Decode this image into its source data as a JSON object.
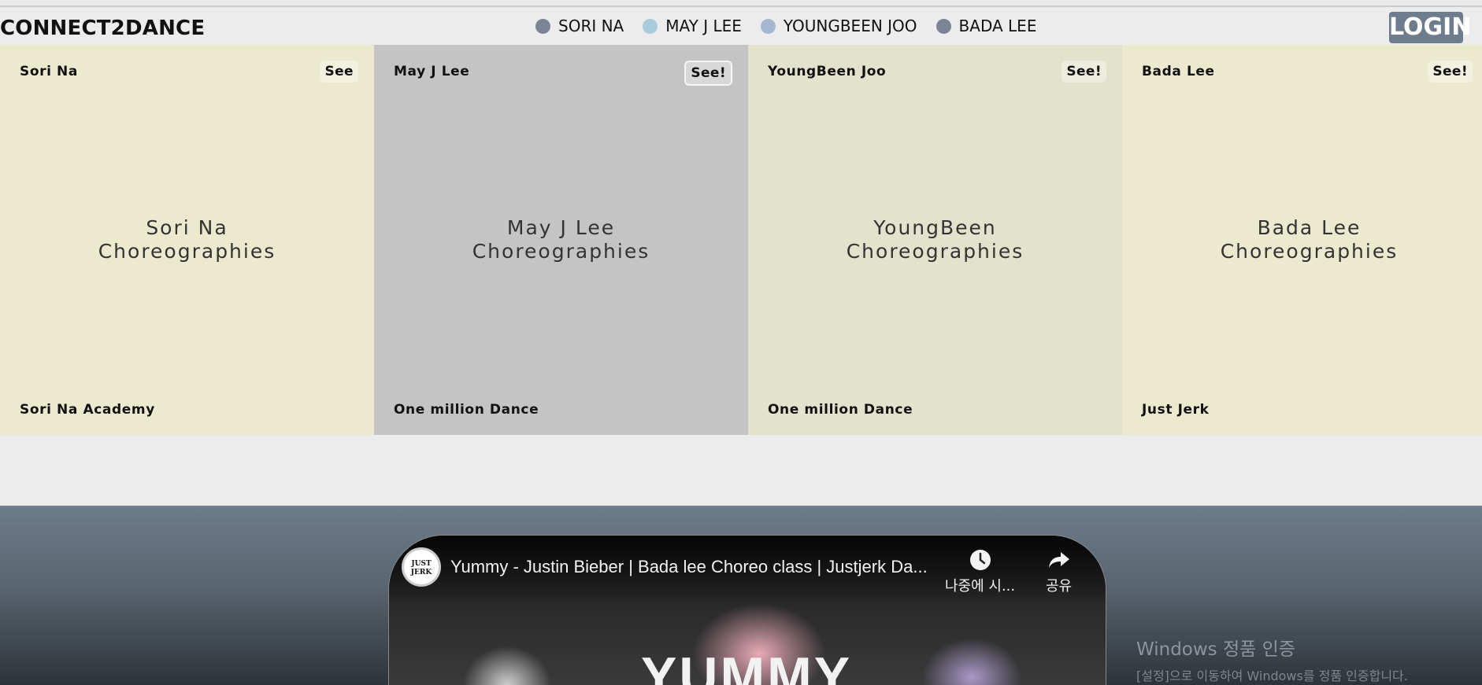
{
  "header": {
    "brand": "CONNECT2DANCE",
    "nav": [
      {
        "label": "SORI NA",
        "color": "#7b8595"
      },
      {
        "label": "MAY J LEE",
        "color": "#a9cbdc"
      },
      {
        "label": "YOUNGBEEN JOO",
        "color": "#a4b7cf"
      },
      {
        "label": "BADA LEE",
        "color": "#7b8595"
      }
    ],
    "login": "LOGIN"
  },
  "cards": [
    {
      "name": "Sori Na",
      "see": "See",
      "line1": "Sori Na",
      "line2": "Choreographies",
      "studio": "Sori Na Academy",
      "bg": "#ebeacf"
    },
    {
      "name": "May J Lee",
      "see": "See!",
      "line1": "May J Lee",
      "line2": "Choreographies",
      "studio": "One million Dance",
      "bg": "#c4c4c4"
    },
    {
      "name": "YoungBeen Joo",
      "see": "See!",
      "line1": "YoungBeen",
      "line2": "Choreographies",
      "studio": "One million Dance",
      "bg": "#e3e2cc"
    },
    {
      "name": "Bada Lee",
      "see": "See!",
      "line1": "Bada Lee",
      "line2": "Choreographies",
      "studio": "Just Jerk",
      "bg": "#ebeacf"
    }
  ],
  "video": {
    "channel_logo": "JUST JERK",
    "title": "Yummy - Justin Bieber | Bada lee Choreo class | Justjerk Da...",
    "watch_later": "나중에 시...",
    "share": "공유",
    "overlay_text": "YUMMY"
  },
  "watermark": {
    "line1": "Windows 정품 인증",
    "line2": "[설정]으로 이동하여 Windows를 정품 인증합니다."
  }
}
